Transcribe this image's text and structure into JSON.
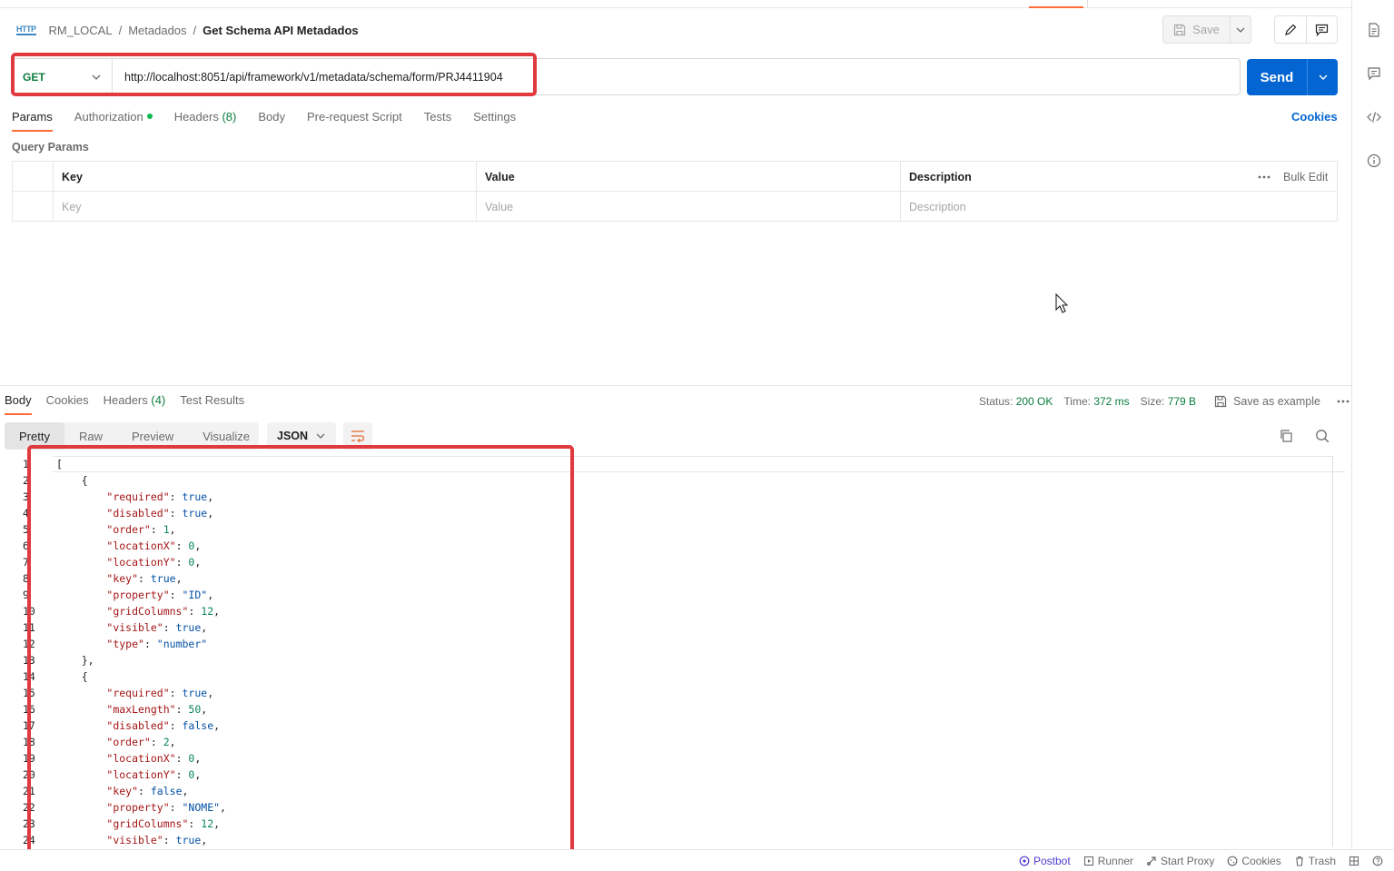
{
  "breadcrumb": {
    "protocol_icon": "HTTP",
    "collection": "RM_LOCAL",
    "folder": "Metadados",
    "separator": "/",
    "request_name": "Get Schema API Metadados"
  },
  "toolbar": {
    "save_label": "Save"
  },
  "request": {
    "method": "GET",
    "url": "http://localhost:8051/api/framework/v1/metadata/schema/form/PRJ4411904",
    "send_label": "Send"
  },
  "request_tabs": [
    {
      "label": "Params",
      "count": ""
    },
    {
      "label": "Authorization",
      "count": ""
    },
    {
      "label": "Headers",
      "count": "(8)"
    },
    {
      "label": "Body",
      "count": ""
    },
    {
      "label": "Pre-request Script",
      "count": ""
    },
    {
      "label": "Tests",
      "count": ""
    },
    {
      "label": "Settings",
      "count": ""
    }
  ],
  "cookies_link": "Cookies",
  "query_params": {
    "title": "Query Params",
    "columns": [
      "Key",
      "Value",
      "Description"
    ],
    "placeholders": [
      "Key",
      "Value",
      "Description"
    ],
    "bulk_edit": "Bulk Edit"
  },
  "response_tabs": [
    {
      "label": "Body",
      "count": ""
    },
    {
      "label": "Cookies",
      "count": ""
    },
    {
      "label": "Headers",
      "count": "(4)"
    },
    {
      "label": "Test Results",
      "count": ""
    }
  ],
  "response_meta": {
    "status_label": "Status:",
    "status_value": "200 OK",
    "time_label": "Time:",
    "time_value": "372 ms",
    "size_label": "Size:",
    "size_value": "779 B",
    "save_example": "Save as example"
  },
  "view_tabs": [
    "Pretty",
    "Raw",
    "Preview",
    "Visualize"
  ],
  "format": "JSON",
  "code_lines": [
    {
      "n": "1",
      "indent": 0,
      "p": "["
    },
    {
      "n": "2",
      "indent": 1,
      "p": "{"
    },
    {
      "n": "3",
      "indent": 2,
      "k": "\"required\"",
      "v": "true",
      "t": "b",
      "c": ","
    },
    {
      "n": "4",
      "indent": 2,
      "k": "\"disabled\"",
      "v": "true",
      "t": "b",
      "c": ","
    },
    {
      "n": "5",
      "indent": 2,
      "k": "\"order\"",
      "v": "1",
      "t": "n",
      "c": ","
    },
    {
      "n": "6",
      "indent": 2,
      "k": "\"locationX\"",
      "v": "0",
      "t": "n",
      "c": ","
    },
    {
      "n": "7",
      "indent": 2,
      "k": "\"locationY\"",
      "v": "0",
      "t": "n",
      "c": ","
    },
    {
      "n": "8",
      "indent": 2,
      "k": "\"key\"",
      "v": "true",
      "t": "b",
      "c": ","
    },
    {
      "n": "9",
      "indent": 2,
      "k": "\"property\"",
      "v": "\"ID\"",
      "t": "s",
      "c": ","
    },
    {
      "n": "10",
      "indent": 2,
      "k": "\"gridColumns\"",
      "v": "12",
      "t": "n",
      "c": ","
    },
    {
      "n": "11",
      "indent": 2,
      "k": "\"visible\"",
      "v": "true",
      "t": "b",
      "c": ","
    },
    {
      "n": "12",
      "indent": 2,
      "k": "\"type\"",
      "v": "\"number\"",
      "t": "s",
      "c": ""
    },
    {
      "n": "13",
      "indent": 1,
      "p": "},"
    },
    {
      "n": "14",
      "indent": 1,
      "p": "{"
    },
    {
      "n": "15",
      "indent": 2,
      "k": "\"required\"",
      "v": "true",
      "t": "b",
      "c": ","
    },
    {
      "n": "16",
      "indent": 2,
      "k": "\"maxLength\"",
      "v": "50",
      "t": "n",
      "c": ","
    },
    {
      "n": "17",
      "indent": 2,
      "k": "\"disabled\"",
      "v": "false",
      "t": "b",
      "c": ","
    },
    {
      "n": "18",
      "indent": 2,
      "k": "\"order\"",
      "v": "2",
      "t": "n",
      "c": ","
    },
    {
      "n": "19",
      "indent": 2,
      "k": "\"locationX\"",
      "v": "0",
      "t": "n",
      "c": ","
    },
    {
      "n": "20",
      "indent": 2,
      "k": "\"locationY\"",
      "v": "0",
      "t": "n",
      "c": ","
    },
    {
      "n": "21",
      "indent": 2,
      "k": "\"key\"",
      "v": "false",
      "t": "b",
      "c": ","
    },
    {
      "n": "22",
      "indent": 2,
      "k": "\"property\"",
      "v": "\"NOME\"",
      "t": "s",
      "c": ","
    },
    {
      "n": "23",
      "indent": 2,
      "k": "\"gridColumns\"",
      "v": "12",
      "t": "n",
      "c": ","
    },
    {
      "n": "24",
      "indent": 2,
      "k": "\"visible\"",
      "v": "true",
      "t": "b",
      "c": ","
    }
  ],
  "statusbar": [
    {
      "label": "Postbot",
      "icon": "postbot-icon"
    },
    {
      "label": "Runner",
      "icon": "runner-icon"
    },
    {
      "label": "Start Proxy",
      "icon": "proxy-icon"
    },
    {
      "label": "Cookies",
      "icon": "cookie-icon"
    },
    {
      "label": "Trash",
      "icon": "trash-icon"
    }
  ],
  "colors": {
    "accent": "#ff6c37",
    "send": "#0265d2",
    "method_get": "#0b7c3e",
    "annotation": "#e0393e"
  }
}
